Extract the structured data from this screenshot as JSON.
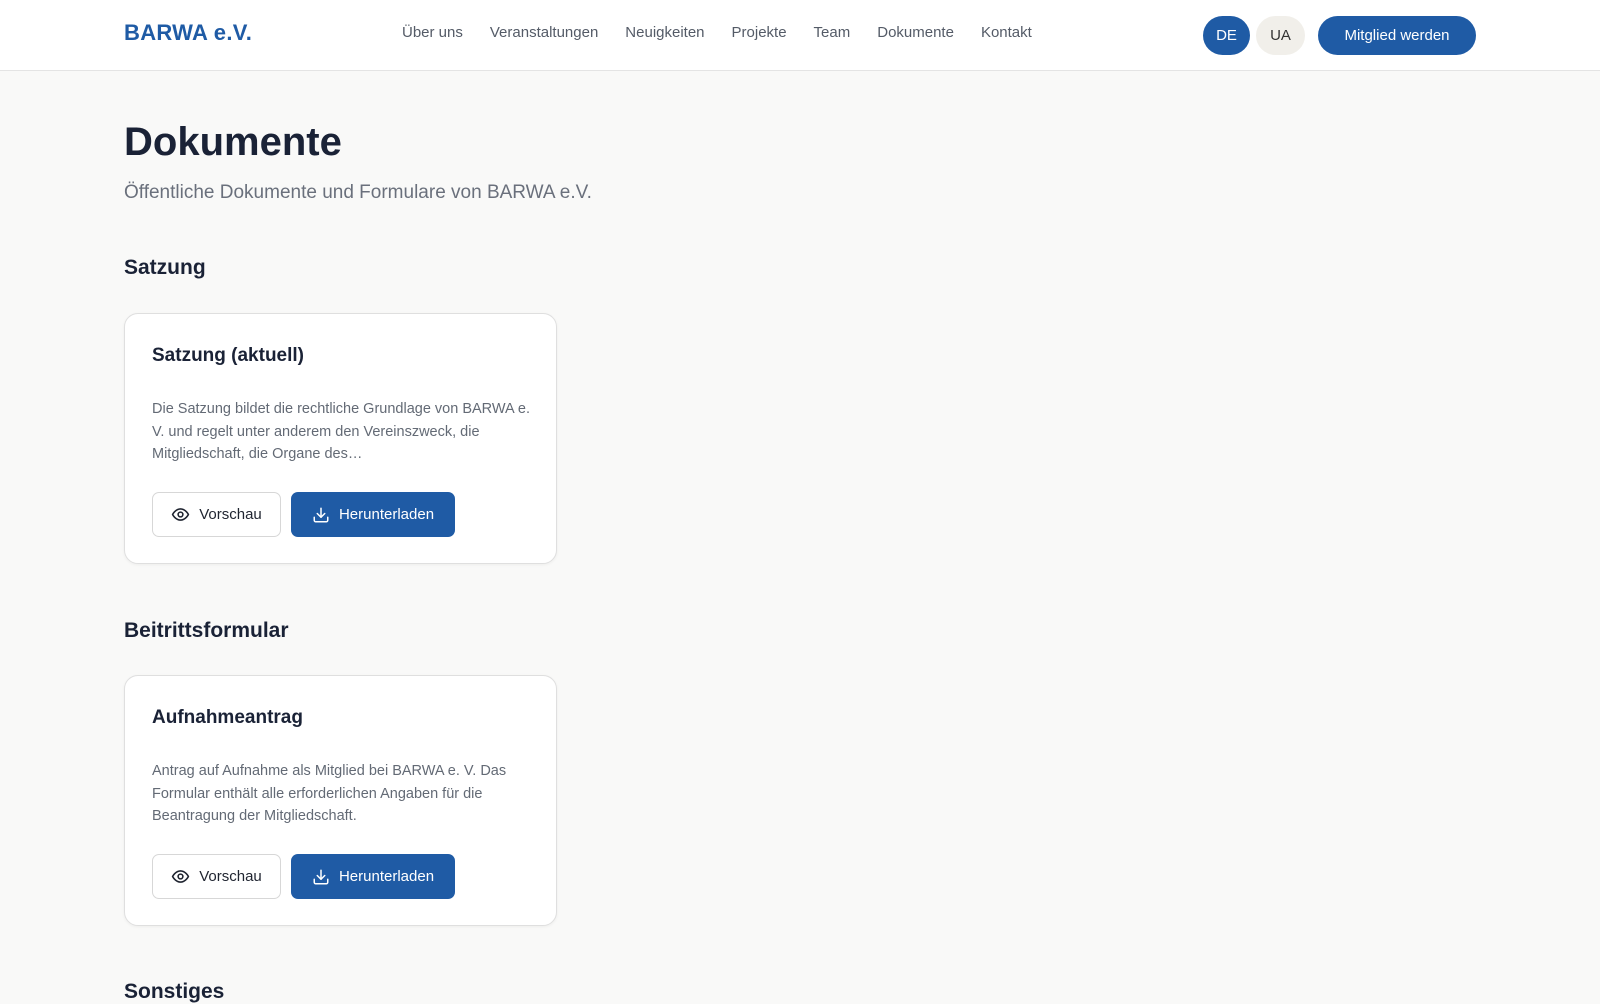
{
  "header": {
    "logo": "BARWA e.V.",
    "nav": [
      "Über uns",
      "Veranstaltungen",
      "Neuigkeiten",
      "Projekte",
      "Team",
      "Dokumente",
      "Kontakt"
    ],
    "lang_de": "DE",
    "lang_ua": "UA",
    "cta": "Mitglied werden"
  },
  "page": {
    "title": "Dokumente",
    "subtitle": "Öffentliche Dokumente und Formulare von BARWA e.V."
  },
  "sections": [
    {
      "title": "Satzung",
      "card": {
        "title": "Satzung (aktuell)",
        "description": "Die Satzung bildet die rechtliche Grundlage von BARWA e. V. und regelt unter anderem den Vereinszweck, die Mitgliedschaft, die Organe des…",
        "preview_label": "Vorschau",
        "download_label": "Herunterladen"
      }
    },
    {
      "title": "Beitrittsformular",
      "card": {
        "title": "Aufnahmeantrag",
        "description": "Antrag auf Aufnahme als Mitglied bei BARWA e. V. Das Formular enthält alle erforderlichen Angaben für die Beantragung der Mitgliedschaft.",
        "preview_label": "Vorschau",
        "download_label": "Herunterladen"
      }
    },
    {
      "title": "Sonstiges"
    }
  ],
  "icons": {
    "preview": "eye-icon",
    "download": "download-icon"
  },
  "colors": {
    "brand": "#1f5ba5",
    "background": "#f9f9f8"
  }
}
